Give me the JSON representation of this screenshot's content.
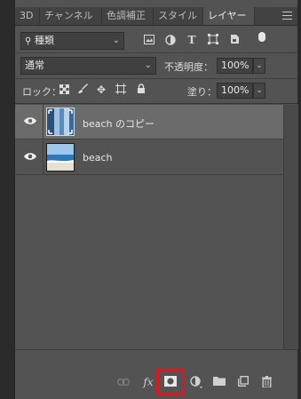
{
  "tabs": [
    {
      "label": "3D"
    },
    {
      "label": "チャンネル"
    },
    {
      "label": "色調補正"
    },
    {
      "label": "スタイル"
    },
    {
      "label": "レイヤー"
    }
  ],
  "filter": {
    "label": "種類"
  },
  "blend": {
    "mode": "通常",
    "opacity_label": "不透明度：",
    "opacity_value": "100%"
  },
  "lock": {
    "label": "ロック：",
    "fill_label": "塗り：",
    "fill_value": "100%"
  },
  "layers": [
    {
      "name": "beach のコピー",
      "selected": true
    },
    {
      "name": "beach",
      "selected": false
    }
  ],
  "bottom_icons": [
    "link-icon",
    "fx-icon",
    "mask-icon",
    "adjustment-icon",
    "folder-icon",
    "new-layer-icon",
    "trash-icon"
  ],
  "colors": {
    "highlight": "#e0161e",
    "panel": "#535353",
    "selected_row": "#6b6b6b"
  }
}
